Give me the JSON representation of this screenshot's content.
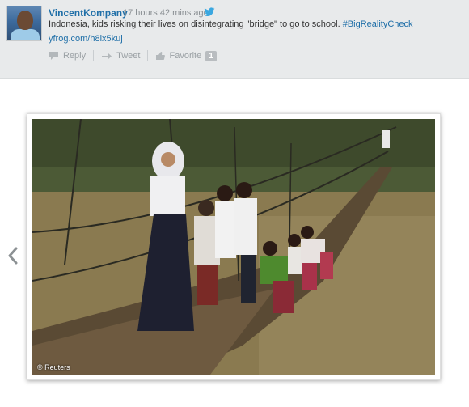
{
  "tweet": {
    "username": "VincentKompany",
    "time": "17 hours 42 mins ago",
    "text": "Indonesia, kids risking their lives on disintegrating \"bridge\" to go to school. ",
    "hashtag": "#BigRealityCheck",
    "link": "yfrog.com/h8lx5kuj",
    "actions": {
      "reply": "Reply",
      "retweet": "Tweet",
      "favorite": "Favorite",
      "favorite_count": "1"
    },
    "avatar_icon": "profile-photo",
    "source_icon": "twitter-bird-icon"
  },
  "photo": {
    "credit": "© Reuters"
  },
  "nav": {
    "prev_icon": "chevron-left-icon"
  },
  "colors": {
    "link": "#1f6fa8",
    "header_bg": "#e8eaeb",
    "muted": "#9aa0a4"
  }
}
